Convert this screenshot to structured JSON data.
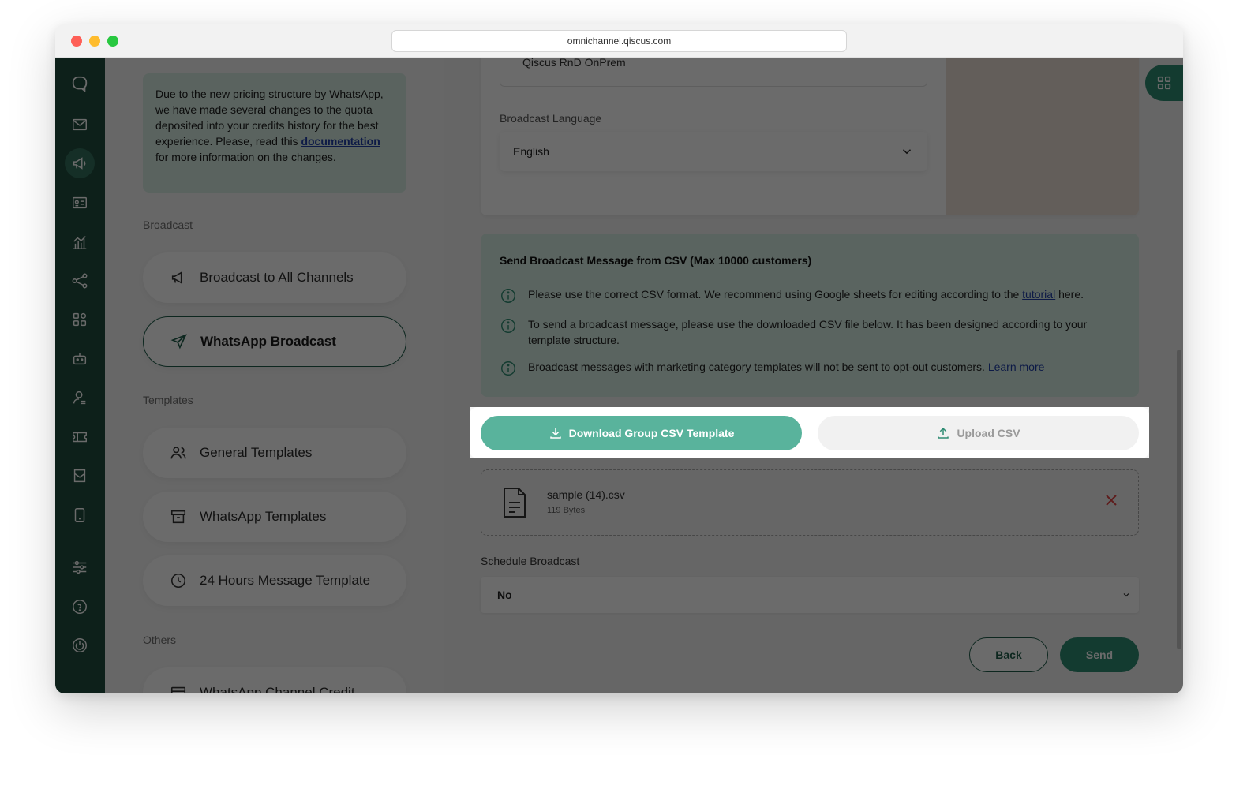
{
  "browser": {
    "url": "omnichannel.qiscus.com"
  },
  "sidemenu": {
    "notice": {
      "text_before": "Due to the new pricing structure by WhatsApp, we have made several changes to the quota deposited into your credits history for the best experience. Please, read this ",
      "link": "documentation",
      "text_after": " for more information on the changes."
    },
    "section_broadcast": "Broadcast",
    "broadcast_all": "Broadcast to All Channels",
    "whatsapp_broadcast": "WhatsApp Broadcast",
    "section_templates": "Templates",
    "general_templates": "General Templates",
    "whatsapp_templates": "WhatsApp Templates",
    "hours_template": "24 Hours Message Template",
    "section_others": "Others",
    "channel_credit": "WhatsApp Channel Credit"
  },
  "form": {
    "channel_value": "Qiscus RnD OnPrem",
    "language_label": "Broadcast Language",
    "language_value": "English",
    "csv_title": "Send Broadcast Message from CSV (Max 10000 customers)",
    "info1_before": "Please use the correct CSV format. We recommend using Google sheets for editing according to the ",
    "info1_link": "tutorial",
    "info1_after": " here.",
    "info2": "To send a broadcast message, please use the downloaded CSV file below. It has been designed according to your template structure.",
    "info3_before": "Broadcast messages with marketing category templates will not be sent to opt-out customers. ",
    "info3_link": "Learn more",
    "download_button": "Download Group CSV Template",
    "upload_button": "Upload CSV",
    "file_name": "sample (14).csv",
    "file_size": "119 Bytes",
    "schedule_label": "Schedule Broadcast",
    "schedule_value": "No",
    "back_button": "Back",
    "send_button": "Send"
  },
  "colors": {
    "rail": "#1f4d3f",
    "accent": "#2f8c73",
    "download_button": "#59b39c",
    "info_box": "#d7eee4"
  }
}
